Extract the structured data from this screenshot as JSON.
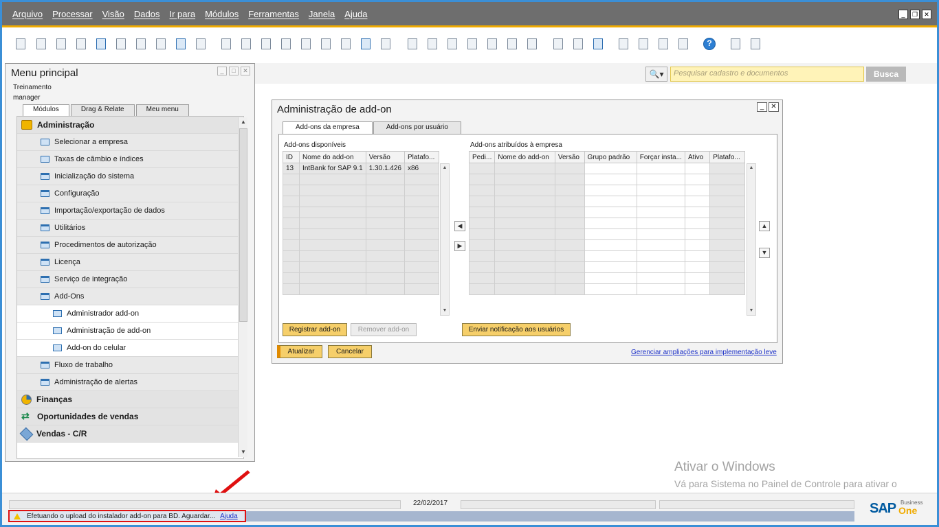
{
  "menubar": {
    "items": [
      "Arquivo",
      "Processar",
      "Visão",
      "Dados",
      "Ir para",
      "Módulos",
      "Ferramentas",
      "Janela",
      "Ajuda"
    ]
  },
  "search": {
    "placeholder": "Pesquisar cadastro e documentos",
    "button_label": "Busca"
  },
  "main_menu": {
    "title": "Menu principal",
    "user_line1": "Treinamento",
    "user_line2": "manager",
    "tabs": [
      "Módulos",
      "Drag & Relate",
      "Meu menu"
    ],
    "items": [
      {
        "label": "Administração",
        "level": "top",
        "icon": "administration-icon"
      },
      {
        "label": "Selecionar a empresa",
        "level": "sub",
        "icon": "form-icon"
      },
      {
        "label": "Taxas de câmbio e índices",
        "level": "sub",
        "icon": "form-icon"
      },
      {
        "label": "Inicialização do sistema",
        "level": "sub",
        "icon": "folder-icon"
      },
      {
        "label": "Configuração",
        "level": "sub",
        "icon": "folder-icon"
      },
      {
        "label": "Importação/exportação de dados",
        "level": "sub",
        "icon": "folder-icon"
      },
      {
        "label": "Utilitários",
        "level": "sub",
        "icon": "folder-icon"
      },
      {
        "label": "Procedimentos de autorização",
        "level": "sub",
        "icon": "folder-icon"
      },
      {
        "label": "Licença",
        "level": "sub",
        "icon": "folder-icon"
      },
      {
        "label": "Serviço de integração",
        "level": "sub",
        "icon": "folder-icon"
      },
      {
        "label": "Add-Ons",
        "level": "sub",
        "icon": "folder-open-icon"
      },
      {
        "label": "Administrador add-on",
        "level": "subsub",
        "icon": "form-icon"
      },
      {
        "label": "Administração de add-on",
        "level": "subsub",
        "icon": "form-icon"
      },
      {
        "label": "Add-on do celular",
        "level": "subsub",
        "icon": "form-icon"
      },
      {
        "label": "Fluxo de trabalho",
        "level": "sub",
        "icon": "folder-icon"
      },
      {
        "label": "Administração de alertas",
        "level": "sub",
        "icon": "folder-icon"
      },
      {
        "label": "Finanças",
        "level": "top",
        "icon": "finance-pie-icon"
      },
      {
        "label": "Oportunidades de vendas",
        "level": "top",
        "icon": "opportunities-arrows-icon"
      },
      {
        "label": "Vendas - C/R",
        "level": "top",
        "icon": "sales-tag-icon"
      }
    ]
  },
  "dialog": {
    "title": "Administração de add-on",
    "tabs": [
      "Add-ons da empresa",
      "Add-ons por usuário"
    ],
    "available_label": "Add-ons disponíveis",
    "available_columns": [
      "ID",
      "Nome do add-on",
      "Versão",
      "Platafo..."
    ],
    "available_rows": [
      [
        "13",
        "IntBank for SAP 9.1",
        "1.30.1.426",
        "x86"
      ]
    ],
    "assigned_label": "Add-ons atribuídos à empresa",
    "assigned_columns": [
      "Pedi...",
      "Nome do add-on",
      "Versão",
      "Grupo padrão",
      "Forçar insta...",
      "Ativo",
      "Platafo..."
    ],
    "register_button": "Registrar add-on",
    "remove_button": "Remover add-on",
    "notify_button": "Enviar notificação aos usuários",
    "update_button": "Atualizar",
    "cancel_button": "Cancelar",
    "manage_link": "Gerenciar ampliações para implementação leve"
  },
  "watermark": {
    "line1": "Ativar o Windows",
    "line2": "Vá para Sistema no Painel de Controle para ativar o Windows."
  },
  "statusbar": {
    "date": "22/02/2017",
    "message": "Efetuando o upload do instalador add-on para BD. Aguardar...",
    "help_link": "Ajuda",
    "logo_main": "SAP",
    "logo_business": "Business",
    "logo_one": "One"
  },
  "colors": {
    "accent": "#f0ab00",
    "menubar": "#6e6e6e",
    "button_yellow": "#f6cf6a",
    "highlight_red": "#e01010"
  }
}
